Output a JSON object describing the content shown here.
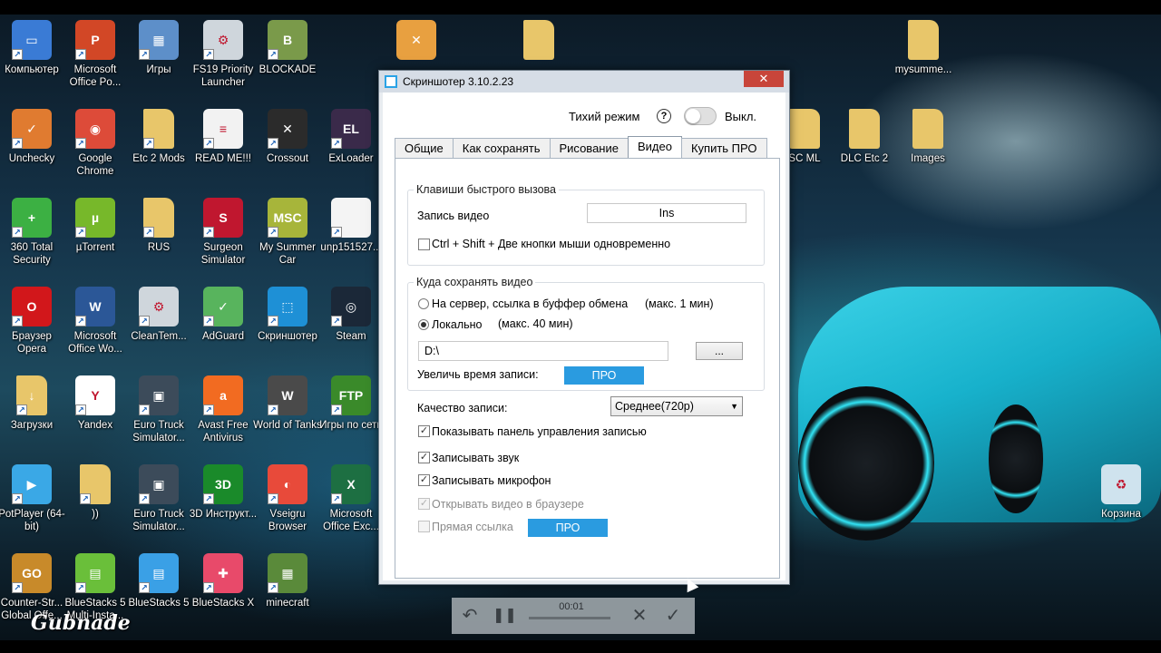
{
  "desktop": {
    "icons": [
      {
        "label": "Компьютер",
        "icon": "computer-icon",
        "color": "#3a7bd5",
        "glyph": "▭"
      },
      {
        "label": "Microsoft Office Po...",
        "icon": "powerpoint-icon",
        "color": "#d24726",
        "glyph": "P"
      },
      {
        "label": "Игры",
        "icon": "games-folder-icon",
        "color": "#5d8fc9",
        "glyph": "▦"
      },
      {
        "label": "FS19 Priority Launcher",
        "icon": "settings-app-icon",
        "color": "#cfd6dc",
        "glyph": "⚙"
      },
      {
        "label": "BLOCKADE",
        "icon": "blockade-icon",
        "color": "#7a9a4a",
        "glyph": "B"
      },
      {
        "label": "Unchecky",
        "icon": "unchecky-icon",
        "color": "#e07b30",
        "glyph": "✓"
      },
      {
        "label": "Google Chrome",
        "icon": "chrome-icon",
        "color": "#dd4b39",
        "glyph": "◉"
      },
      {
        "label": "Etc 2 Mods",
        "icon": "folder-icon",
        "color": "#e8c66a",
        "glyph": ""
      },
      {
        "label": "READ ME!!!",
        "icon": "text-file-icon",
        "color": "#f2f2f2",
        "glyph": "≡"
      },
      {
        "label": "Crossout",
        "icon": "crossout-icon",
        "color": "#2b2b2b",
        "glyph": "✕"
      },
      {
        "label": "ExLoader",
        "icon": "exloader-icon",
        "color": "#3a2a4a",
        "glyph": "EL"
      },
      {
        "label": "360 Total Security",
        "icon": "360-security-icon",
        "color": "#3cb043",
        "glyph": "+"
      },
      {
        "label": "µTorrent",
        "icon": "utorrent-icon",
        "color": "#77b82a",
        "glyph": "µ"
      },
      {
        "label": "RUS",
        "icon": "folder-icon",
        "color": "#e8c66a",
        "glyph": ""
      },
      {
        "label": "Surgeon Simulator",
        "icon": "surgeon-simulator-icon",
        "color": "#c0172f",
        "glyph": "S"
      },
      {
        "label": "My Summer Car",
        "icon": "my-summer-car-icon",
        "color": "#a7b53a",
        "glyph": "MSC"
      },
      {
        "label": "unp151527...",
        "icon": "blank-file-icon",
        "color": "#f4f4f4",
        "glyph": ""
      },
      {
        "label": "Браузер Opera",
        "icon": "opera-icon",
        "color": "#d2171b",
        "glyph": "O"
      },
      {
        "label": "Microsoft Office Wo...",
        "icon": "word-icon",
        "color": "#2b5797",
        "glyph": "W"
      },
      {
        "label": "CleanTem...",
        "icon": "cleantemp-icon",
        "color": "#cfd6dc",
        "glyph": "⚙"
      },
      {
        "label": "AdGuard",
        "icon": "adguard-icon",
        "color": "#58b45d",
        "glyph": "✓"
      },
      {
        "label": "Скриншотер",
        "icon": "screenshoter-icon",
        "color": "#1e90d6",
        "glyph": "⬚"
      },
      {
        "label": "Steam",
        "icon": "steam-icon",
        "color": "#1b2838",
        "glyph": "◎"
      },
      {
        "label": "Загрузки",
        "icon": "downloads-folder-icon",
        "color": "#e8c66a",
        "glyph": "↓"
      },
      {
        "label": "Yandex",
        "icon": "yandex-icon",
        "color": "#ffffff",
        "glyph": "Y"
      },
      {
        "label": "Euro Truck Simulator...",
        "icon": "euro-truck-icon",
        "color": "#3c4b5a",
        "glyph": "▣"
      },
      {
        "label": "Avast Free Antivirus",
        "icon": "avast-icon",
        "color": "#f26b21",
        "glyph": "a"
      },
      {
        "label": "World of Tanks",
        "icon": "world-of-tanks-icon",
        "color": "#4a4a4a",
        "glyph": "W"
      },
      {
        "label": "Игры по сети",
        "icon": "ftp-icon",
        "color": "#3a8a2a",
        "glyph": "FTP"
      },
      {
        "label": "PotPlayer (64-bit)",
        "icon": "potplayer-icon",
        "color": "#3aa8e6",
        "glyph": "▶"
      },
      {
        "label": "))",
        "icon": "folder-icon",
        "color": "#e8c66a",
        "glyph": ""
      },
      {
        "label": "Euro Truck Simulator...",
        "icon": "euro-truck-icon",
        "color": "#3c4b5a",
        "glyph": "▣"
      },
      {
        "label": "3D Инструкт...",
        "icon": "3d-instructor-icon",
        "color": "#1a8a2a",
        "glyph": "3D"
      },
      {
        "label": "Vseigru Browser",
        "icon": "vseigru-icon",
        "color": "#e84a3a",
        "glyph": "◐"
      },
      {
        "label": "Microsoft Office Exc...",
        "icon": "excel-icon",
        "color": "#1d6f42",
        "glyph": "X"
      },
      {
        "label": "Counter-Str... Global Offe...",
        "icon": "csgo-icon",
        "color": "#c88a2a",
        "glyph": "GO"
      },
      {
        "label": "BlueStacks 5 Multi-Insta...",
        "icon": "bluestacks-multi-icon",
        "color": "#6abf3a",
        "glyph": "▤"
      },
      {
        "label": "BlueStacks 5",
        "icon": "bluestacks-icon",
        "color": "#3aa0e6",
        "glyph": "▤"
      },
      {
        "label": "BlueStacks X",
        "icon": "bluestacks-x-icon",
        "color": "#e84a6a",
        "glyph": "✚"
      },
      {
        "label": "minecraft",
        "icon": "minecraft-icon",
        "color": "#5a8a3a",
        "glyph": "▦"
      },
      {
        "label": "",
        "icon": "ccleaner-broom-icon",
        "color": "#e8a040",
        "glyph": "✕"
      },
      {
        "label": "",
        "icon": "folder-icon",
        "color": "#e8c66a",
        "glyph": ""
      },
      {
        "label": "mysumme...",
        "icon": "folder-icon",
        "color": "#e8c66a",
        "glyph": ""
      },
      {
        "label": "SC ML",
        "icon": "folder-icon",
        "color": "#e8c66a",
        "glyph": ""
      },
      {
        "label": "DLC Etc 2",
        "icon": "folder-icon",
        "color": "#e8c66a",
        "glyph": ""
      },
      {
        "label": "Images",
        "icon": "folder-icon",
        "color": "#e8c66a",
        "glyph": ""
      },
      {
        "label": "Корзина",
        "icon": "recycle-bin-icon",
        "color": "#cfe3ee",
        "glyph": "♻"
      }
    ]
  },
  "window": {
    "title": "Скриншотер 3.10.2.23",
    "close_glyph": "✕",
    "quiet_mode": {
      "label": "Тихий режим",
      "help": "?",
      "state": "Выкл."
    },
    "tabs": [
      "Общие",
      "Как сохранять",
      "Рисование",
      "Видео",
      "Купить ПРО"
    ],
    "active_tab": "Видео",
    "hotkeys": {
      "title": "Клавиши быстрого вызова",
      "record_label": "Запись видео",
      "record_value": "Ins",
      "combo_label": "Ctrl + Shift + Две кнопки мыши одновременно"
    },
    "save_location": {
      "title": "Куда сохранять видео",
      "server_label": "На сервер, ссылка в буффер обмена",
      "server_limit": "(макс. 1 мин)",
      "local_label": "Локально",
      "local_limit": "(макс. 40 мин)",
      "path": "D:\\",
      "browse": "...",
      "increase_label": "Увеличь время записи:",
      "pro": "ПРО"
    },
    "quality": {
      "label": "Качество записи:",
      "value": "Среднее(720p)"
    },
    "options": {
      "show_panel": "Показывать панель управления записью",
      "record_sound": "Записывать звук",
      "record_mic": "Записывать микрофон",
      "open_browser": "Открывать видео в браузере",
      "direct_link": "Прямая ссылка",
      "pro": "ПРО"
    }
  },
  "recorder": {
    "time": "00:01",
    "undo": "↶",
    "pause": "❚❚",
    "cancel": "✕",
    "confirm": "✓"
  },
  "watermark": "Gubnade"
}
